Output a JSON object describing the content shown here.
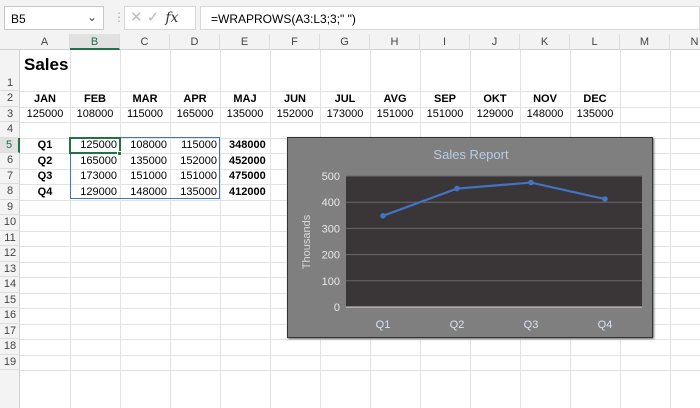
{
  "name_box": "B5",
  "formula": "=WRAPROWS(A3:L3;3;\" \")",
  "columns": [
    "A",
    "B",
    "C",
    "D",
    "E",
    "F",
    "G",
    "H",
    "I",
    "J",
    "K",
    "L",
    "M",
    "N"
  ],
  "rows": [
    "1",
    "2",
    "3",
    "4",
    "5",
    "6",
    "7",
    "8",
    "9",
    "10",
    "11",
    "12",
    "13",
    "14",
    "15",
    "16",
    "17",
    "18",
    "19"
  ],
  "sheet_title": "Sales",
  "months": [
    "JAN",
    "FEB",
    "MAR",
    "APR",
    "MAJ",
    "JUN",
    "JUL",
    "AVG",
    "SEP",
    "OKT",
    "NOV",
    "DEC"
  ],
  "month_values": [
    "125000",
    "108000",
    "115000",
    "165000",
    "135000",
    "152000",
    "173000",
    "151000",
    "151000",
    "129000",
    "148000",
    "135000"
  ],
  "quarters": [
    {
      "label": "Q1",
      "values": [
        "125000",
        "108000",
        "115000"
      ],
      "total": "348000"
    },
    {
      "label": "Q2",
      "values": [
        "165000",
        "135000",
        "152000"
      ],
      "total": "452000"
    },
    {
      "label": "Q3",
      "values": [
        "173000",
        "151000",
        "151000"
      ],
      "total": "475000"
    },
    {
      "label": "Q4",
      "values": [
        "129000",
        "148000",
        "135000"
      ],
      "total": "412000"
    }
  ],
  "chart_data": {
    "type": "line",
    "title": "Sales Report",
    "ylabel": "Thousands",
    "xlabel": "",
    "categories": [
      "Q1",
      "Q2",
      "Q3",
      "Q4"
    ],
    "values": [
      348,
      452,
      475,
      412
    ],
    "ylim": [
      0,
      500
    ],
    "yticks": [
      "0",
      "100",
      "200",
      "300",
      "400",
      "500"
    ],
    "grid": true,
    "series_color": "#4472c4"
  }
}
